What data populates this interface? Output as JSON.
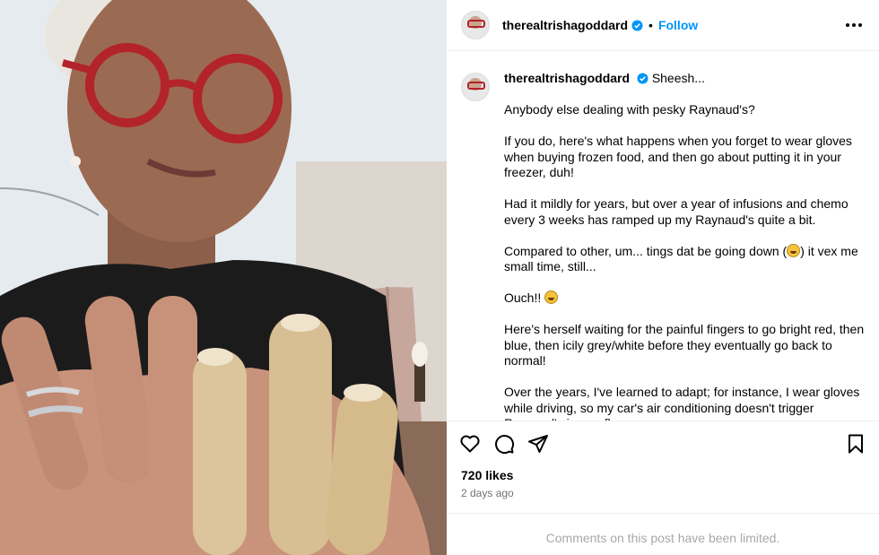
{
  "post": {
    "username": "therealtrishagoddard",
    "follow_label": "Follow",
    "separator": "•",
    "more_label": "•••"
  },
  "caption": {
    "username": "therealtrishagoddard",
    "first_line": "Sheesh...",
    "paragraphs": [
      "Anybody else dealing with pesky Raynaud's?",
      "If you do, here's what happens when you forget to wear gloves when buying frozen food, and then go about putting it in your freezer, duh!",
      "Had it mildly for years, but over a year of infusions and chemo every 3 weeks has ramped up my Raynaud's quite a bit."
    ],
    "compared_before": "Compared to other, um... tings dat be going down (",
    "compared_after": ") it vex me small time, still...",
    "ouch": "Ouch!!",
    "waiting": "Here's herself waiting for the painful fingers to go bright red, then blue, then icily grey/white before they eventually go back to normal!",
    "adapt": "Over the years, I've learned to adapt; for instance, I wear gloves while driving, so my car's air conditioning doesn't trigger Raynaud's in one flare."
  },
  "engagement": {
    "likes": "720 likes",
    "time_ago": "2 days ago"
  },
  "comments_notice": "Comments on this post have been limited.",
  "icons": {
    "like": "heart-icon",
    "comment": "comment-icon",
    "share": "share-icon",
    "save": "bookmark-icon",
    "verified": "verified-badge-icon",
    "options": "more-options-icon"
  },
  "colors": {
    "accent": "#0095f6",
    "muted": "#737373",
    "limited": "#a8a8a8",
    "glasses": "#b3232a"
  }
}
